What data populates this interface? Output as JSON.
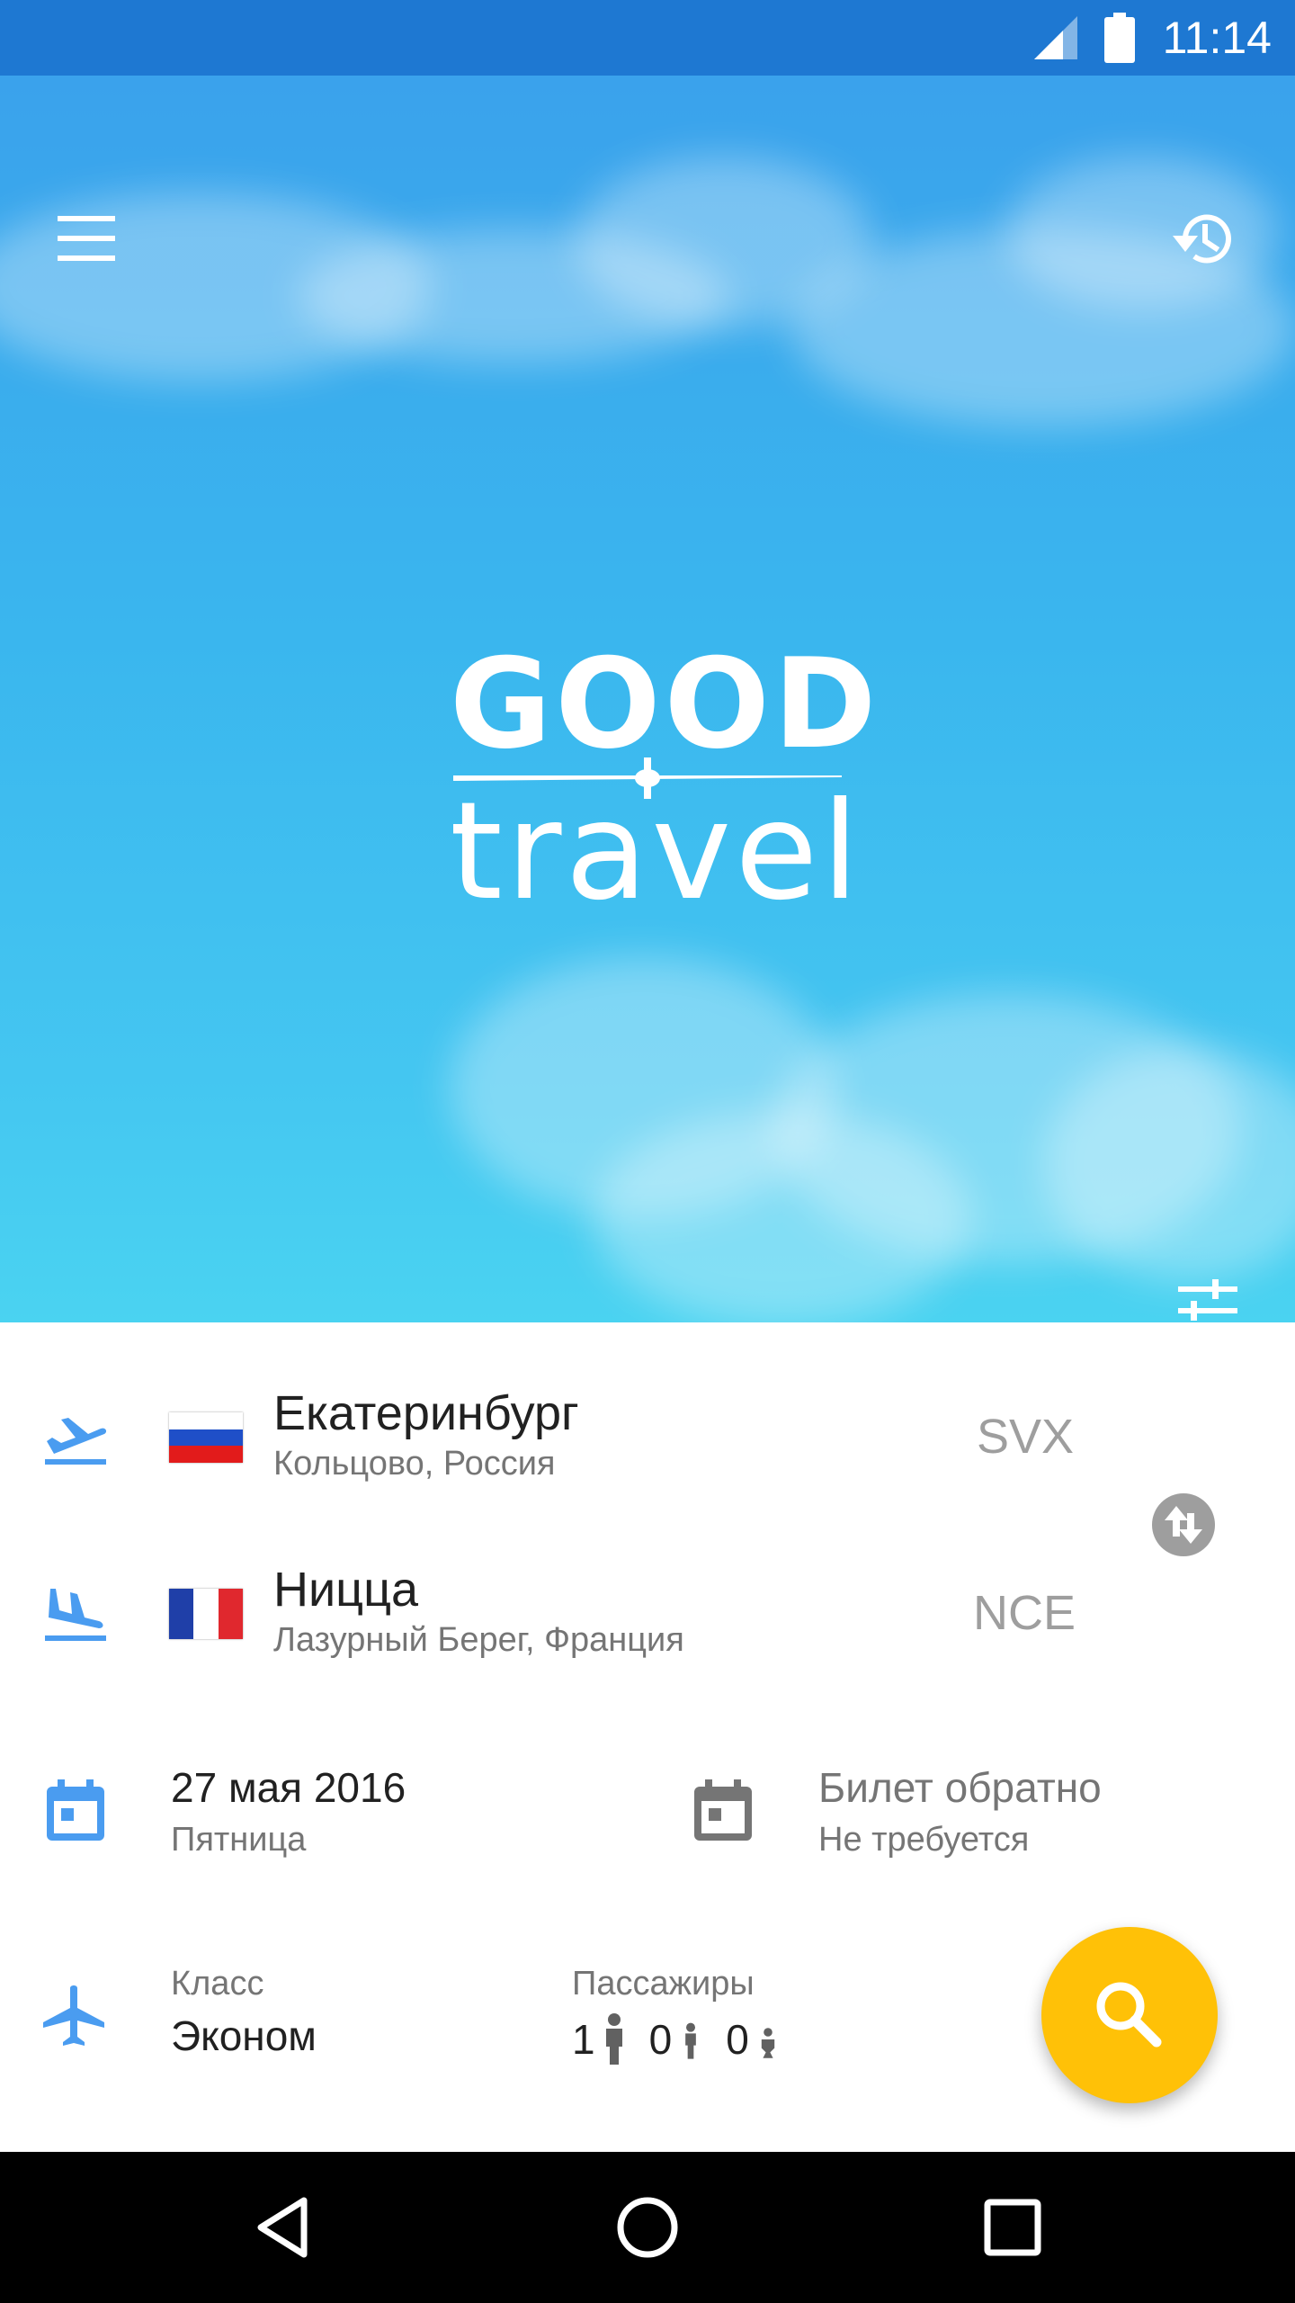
{
  "status_bar": {
    "time": "11:14"
  },
  "logo": {
    "line1": "GOOD",
    "line2": "travel"
  },
  "origin": {
    "city": "Екатеринбург",
    "airport": "Кольцово, Россия",
    "code": "SVX"
  },
  "destination": {
    "city": "Ницца",
    "airport": "Лазурный Берег, Франция",
    "code": "NCE"
  },
  "depart": {
    "date": "27 мая 2016",
    "weekday": "Пятница"
  },
  "return": {
    "title": "Билет обратно",
    "status": "Не требуется"
  },
  "cabin": {
    "label": "Класс",
    "value": "Эконом"
  },
  "passengers": {
    "label": "Пассажиры",
    "adults": "1",
    "children": "0",
    "infants": "0"
  },
  "colors": {
    "accent": "#4a9cf0",
    "fab": "#ffc107",
    "status_bar": "#1e78d2",
    "hero_top": "#3aa2ec",
    "hero_bottom": "#4ad3f1"
  },
  "icons": {
    "menu": "menu-icon",
    "history": "history-icon",
    "tune": "tune-icon",
    "takeoff": "flight-takeoff-icon",
    "landing": "flight-land-icon",
    "calendar": "calendar-icon",
    "plane": "airplane-icon",
    "swap": "swap-icon",
    "search": "search-icon"
  }
}
